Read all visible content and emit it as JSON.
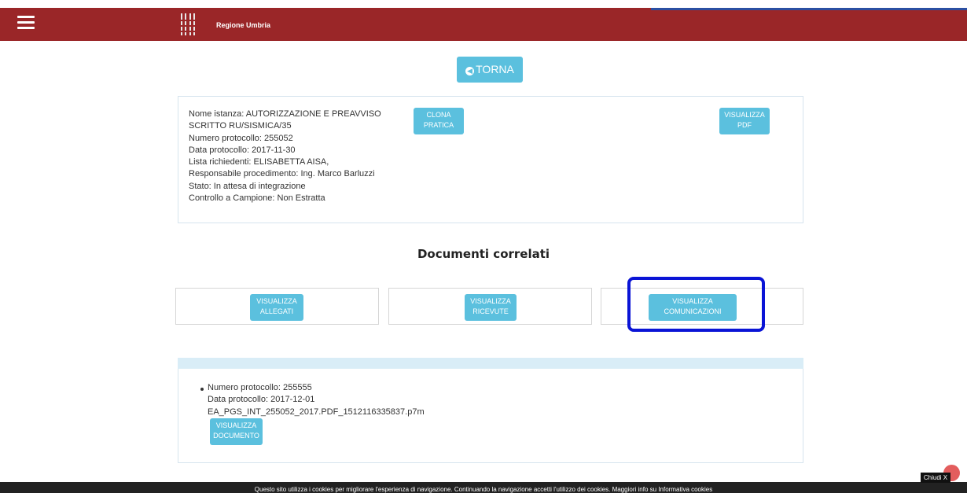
{
  "header": {
    "menu_icon": "hamburger-menu-icon",
    "logo_icon": "regione-umbria-logo",
    "brand": "Regione Umbria",
    "color": "#9a2628"
  },
  "back_button": {
    "label": "TORNA",
    "icon": "arrow-left-circle-icon"
  },
  "pratica": {
    "lines": [
      "Nome istanza: AUTORIZZAZIONE E PREAVVISO",
      "SCRITTO RU/SISMICA/35",
      "Numero protocollo: 255052",
      "Data protocollo: 2017-11-30",
      "Lista richiedenti: ELISABETTA AISA,",
      "Responsabile procedimento: Ing. Marco Barluzzi",
      "Stato: In attesa di integrazione",
      "Controllo a Campione: Non Estratta"
    ],
    "clona_button": [
      "CLONA",
      "PRATICA"
    ],
    "pdf_button": [
      "VISUALIZZA",
      "PDF"
    ]
  },
  "documenti": {
    "title": "Documenti correlati",
    "buttons": [
      [
        "VISUALIZZA",
        "ALLEGATI"
      ],
      [
        "VISUALIZZA",
        "RICEVUTE"
      ],
      [
        "VISUALIZZA",
        "COMUNICAZIONI"
      ]
    ]
  },
  "comunicazione": {
    "lines": [
      "Numero protocollo: 255555",
      "Data protocollo: 2017-12-01",
      "EA_PGS_INT_255052_2017.PDF_1512116335837.p7m"
    ],
    "button": [
      "VISUALIZZA",
      "DOCUMENTO"
    ]
  },
  "cookie": {
    "text": "Questo sito utilizza i cookies per migliorare l'esperienza di navigazione. Continuando la navigazione accetti l'utilizzo dei cookies. Maggiori info su Informativa cookies",
    "close": "Chiudi X"
  },
  "colors": {
    "button": "#5bc0de",
    "highlight": "#0a14d6"
  }
}
